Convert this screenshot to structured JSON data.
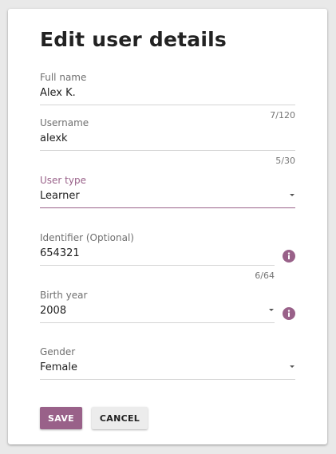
{
  "dialog": {
    "title": "Edit user details"
  },
  "fields": {
    "full_name": {
      "label": "Full name",
      "value": "Alex K.",
      "counter": "7/120"
    },
    "username": {
      "label": "Username",
      "value": "alexk",
      "counter": "5/30"
    },
    "user_type": {
      "label": "User type",
      "value": "Learner"
    },
    "identifier": {
      "label": "Identifier (Optional)",
      "value": "654321",
      "counter": "6/64"
    },
    "birth_year": {
      "label": "Birth year",
      "value": "2008"
    },
    "gender": {
      "label": "Gender",
      "value": "Female"
    }
  },
  "actions": {
    "save_label": "SAVE",
    "cancel_label": "CANCEL"
  },
  "colors": {
    "accent": "#996189",
    "text": "#212121",
    "label": "#6f6f6f"
  },
  "icons": {
    "info": "info-icon",
    "dropdown": "chevron-down-icon"
  }
}
